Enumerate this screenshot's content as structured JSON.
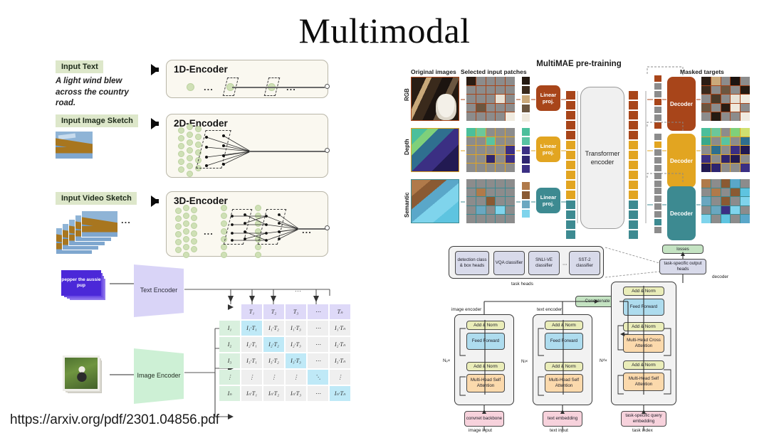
{
  "slide": {
    "title": "Multimodal",
    "source_url": "https://arxiv.org/pdf/2301.04856.pdf"
  },
  "left_figure": {
    "rows": [
      {
        "input_label": "Input Text",
        "input_sample": "A light wind blew across the country road.",
        "encoder_label": "1D-Encoder"
      },
      {
        "input_label": "Input Image Sketch",
        "input_sample": "",
        "encoder_label": "2D-Encoder"
      },
      {
        "input_label": "Input Video Sketch",
        "input_sample": "",
        "encoder_label": "3D-Encoder"
      }
    ],
    "ellipsis": "..."
  },
  "clip_figure": {
    "text_input": "pepper the aussie pup",
    "text_encoder": "Text Encoder",
    "image_encoder": "Image Encoder",
    "text_headers": [
      "T₁",
      "T₂",
      "T₃",
      "⋯",
      "Tₙ"
    ],
    "image_headers": [
      "I₁",
      "I₂",
      "I₃",
      "⋮",
      "Iₙ"
    ],
    "matrix": [
      [
        "I₁·T₁",
        "I₁·T₂",
        "I₁·T₃",
        "⋯",
        "I₁·Tₙ"
      ],
      [
        "I₂·T₁",
        "I₂·T₂",
        "I₂·T₃",
        "⋯",
        "I₂·Tₙ"
      ],
      [
        "I₃·T₁",
        "I₃·T₂",
        "I₃·T₃",
        "⋯",
        "I₃·Tₙ"
      ],
      [
        "⋮",
        "⋮",
        "⋮",
        "⋱",
        "⋮"
      ],
      [
        "Iₙ·T₁",
        "Iₙ·T₂",
        "Iₙ·T₃",
        "⋯",
        "Iₙ·Tₙ"
      ]
    ]
  },
  "multimae": {
    "title": "MultiMAE pre-training",
    "column_labels": {
      "original": "Original images",
      "selected": "Selected input patches",
      "targets": "Masked targets"
    },
    "linear_proj": "Linear proj.",
    "encoder": "Transformer encoder",
    "decoder": "Decoder",
    "modalities": [
      {
        "name": "RGB",
        "color": "#a8451a"
      },
      {
        "name": "Depth",
        "color": "#e2a521"
      },
      {
        "name": "Semantic",
        "color": "#3d8a91"
      }
    ]
  },
  "unified_transformer": {
    "task_heads_caption": "task heads",
    "task_heads": [
      "detection class & box heads",
      "VQA classifier",
      "SNLI-VE classifier",
      "SST-2 classifier"
    ],
    "task_heads_ellipsis": "⋯",
    "losses": "losses",
    "output_heads": "task-specific output heads",
    "decoder_caption": "decoder",
    "concatenate": "Concatenate",
    "columns": [
      {
        "caption": "image encoder",
        "repeat": "Nᵥ×",
        "blocks": [
          "Add & Norm",
          "Feed Forward",
          "Add & Norm",
          "Multi-Head Self Attention"
        ],
        "embedding": "convnet backbone",
        "input_caption": "image input"
      },
      {
        "caption": "text encoder",
        "repeat": "Nₗ×",
        "blocks": [
          "Add & Norm",
          "Feed Forward",
          "Add & Norm",
          "Multi-Head Self Attention"
        ],
        "embedding": "text embedding",
        "input_caption": "text input"
      },
      {
        "caption": "decoder",
        "repeat": "Nᵈ×",
        "blocks": [
          "Add & Norm",
          "Feed Forward",
          "Add & Norm",
          "Multi-Head Cross Attention",
          "Add & Norm",
          "Multi-Head Self Attention"
        ],
        "embedding": "task-specific query embedding",
        "input_caption": "task index"
      }
    ]
  }
}
